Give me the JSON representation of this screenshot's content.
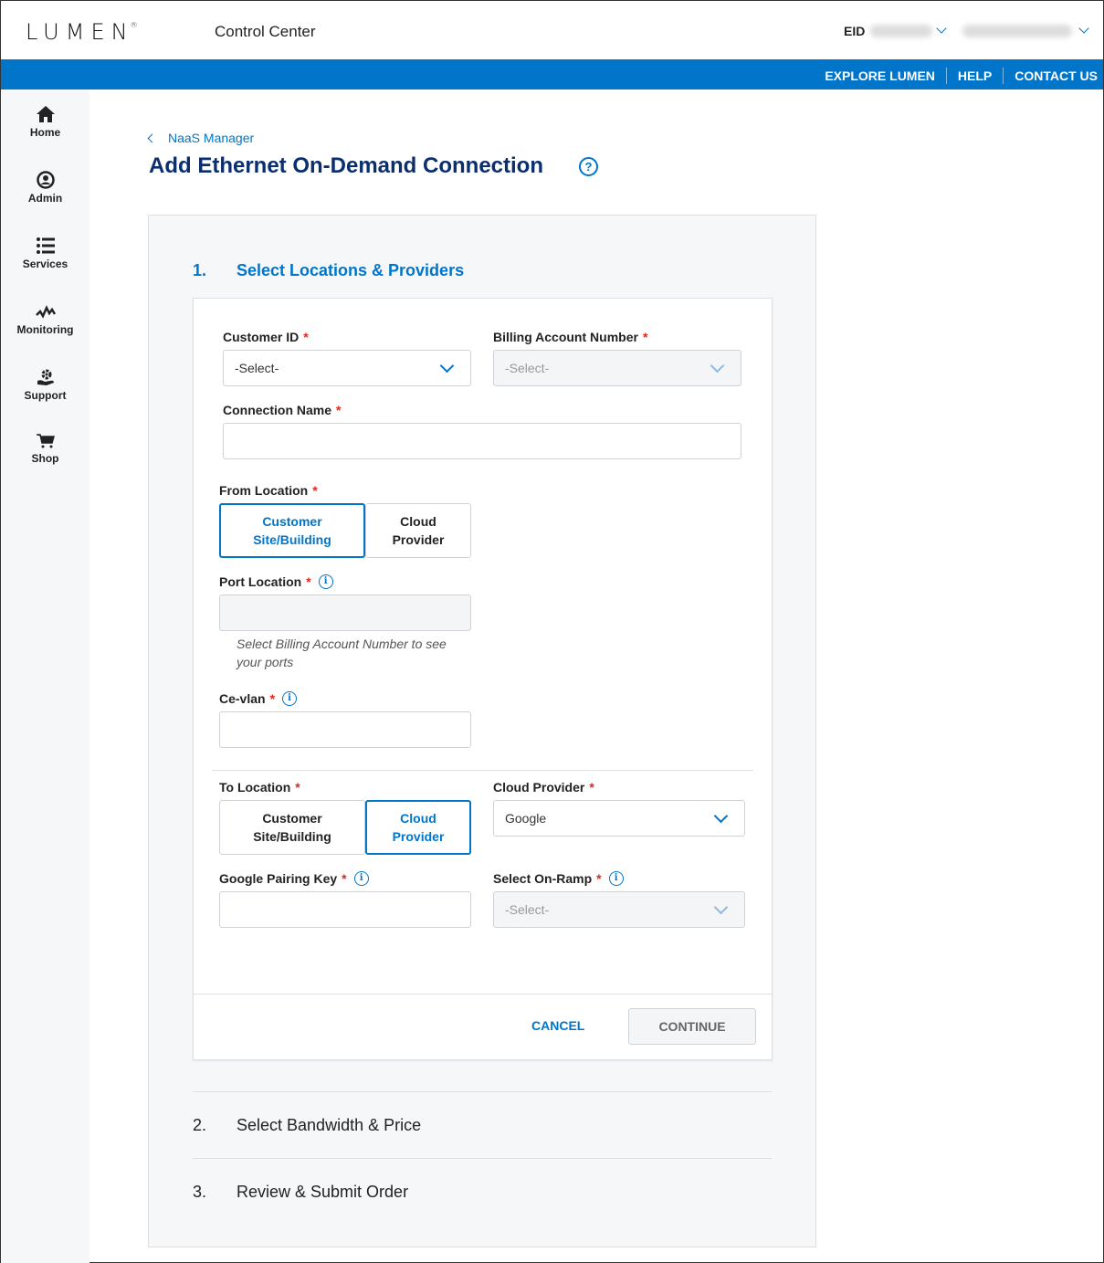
{
  "header": {
    "logo": "LUMEN",
    "app_title": "Control Center",
    "eid_label": "EID",
    "utility_links": [
      "EXPLORE LUMEN",
      "HELP",
      "CONTACT US"
    ]
  },
  "sidenav": {
    "items": [
      {
        "label": "Home",
        "icon": "home-icon"
      },
      {
        "label": "Admin",
        "icon": "user-icon"
      },
      {
        "label": "Services",
        "icon": "list-icon"
      },
      {
        "label": "Monitoring",
        "icon": "pulse-icon"
      },
      {
        "label": "Support",
        "icon": "support-icon"
      },
      {
        "label": "Shop",
        "icon": "cart-icon"
      }
    ]
  },
  "breadcrumb": {
    "label": "NaaS Manager"
  },
  "page": {
    "title": "Add Ethernet On-Demand Connection",
    "help_icon": "?"
  },
  "steps": [
    {
      "number": "1.",
      "label": "Select Locations & Providers",
      "active": true
    },
    {
      "number": "2.",
      "label": "Select Bandwidth & Price",
      "active": false
    },
    {
      "number": "3.",
      "label": "Review & Submit Order",
      "active": false
    }
  ],
  "form": {
    "required_mark": "*",
    "customer_id": {
      "label": "Customer ID",
      "value": "-Select-"
    },
    "billing_account": {
      "label": "Billing Account Number",
      "value": "-Select-",
      "disabled": true
    },
    "connection_name": {
      "label": "Connection Name",
      "value": ""
    },
    "from_location": {
      "label": "From Location",
      "options": [
        {
          "line1": "Customer",
          "line2": "Site/Building",
          "selected": true
        },
        {
          "line1": "Cloud",
          "line2": "Provider",
          "selected": false
        }
      ]
    },
    "port_location": {
      "label": "Port Location",
      "value": "",
      "hint": "Select Billing Account Number to see your ports"
    },
    "ce_vlan": {
      "label": "Ce-vlan",
      "value": ""
    },
    "to_location": {
      "label": "To Location",
      "options": [
        {
          "line1": "Customer",
          "line2": "Site/Building",
          "selected": false
        },
        {
          "line1": "Cloud",
          "line2": "Provider",
          "selected": true
        }
      ]
    },
    "cloud_provider": {
      "label": "Cloud Provider",
      "value": "Google"
    },
    "pairing_key": {
      "label": "Google Pairing Key",
      "value": ""
    },
    "on_ramp": {
      "label": "Select On-Ramp",
      "value": "-Select-",
      "disabled": true
    },
    "info_icon": "i"
  },
  "actions": {
    "cancel": "CANCEL",
    "continue": "CONTINUE"
  }
}
